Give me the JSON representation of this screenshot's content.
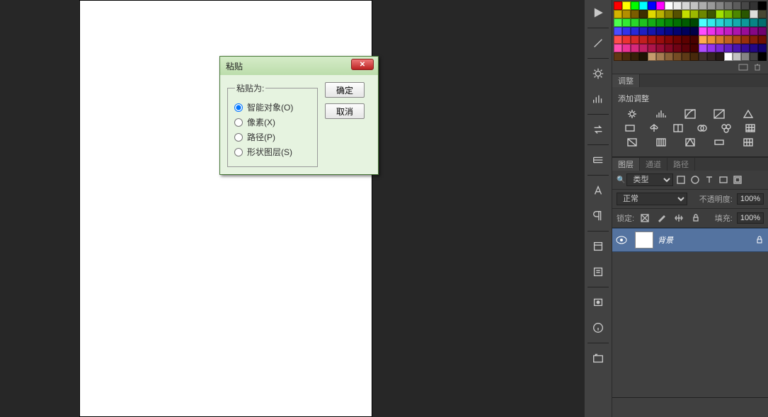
{
  "dialog": {
    "title": "粘贴",
    "fieldset_legend": "粘贴为:",
    "options": [
      {
        "label": "智能对象(O)",
        "checked": true
      },
      {
        "label": "像素(X)",
        "checked": false
      },
      {
        "label": "路径(P)",
        "checked": false
      },
      {
        "label": "形状图层(S)",
        "checked": false
      }
    ],
    "ok": "确定",
    "cancel": "取消"
  },
  "adjustments": {
    "tab": "调整",
    "add_label": "添加调整"
  },
  "layers_panel": {
    "tabs": {
      "layers": "图层",
      "channels": "通道",
      "paths": "路径"
    },
    "kind_select": "类型",
    "search_icon": "🔍",
    "blend_mode": "正常",
    "opacity_label": "不透明度:",
    "opacity_value": "100%",
    "lock_label": "锁定:",
    "fill_label": "填充:",
    "fill_value": "100%",
    "bg_layer": "背景"
  },
  "swatch_rows": [
    [
      "#ff0000",
      "#ffff00",
      "#00ff00",
      "#00ffff",
      "#0000ff",
      "#ff00ff",
      "#ffffff",
      "#ebebeb",
      "#d6d6d6",
      "#c2c2c2",
      "#adadad",
      "#999999",
      "#858585",
      "#707070",
      "#5c5c5c",
      "#474747",
      "#333333",
      "#000000"
    ],
    [
      "#d4b300",
      "#b38f00",
      "#7a5c00",
      "#3d2e00",
      "#e0d900",
      "#b8b100",
      "#878200",
      "#565100",
      "#c4e000",
      "#9cb800",
      "#6d8700",
      "#3e5600",
      "#a0e000",
      "#78b800",
      "#4d8700",
      "#2a5600",
      "#dededb",
      "#474733"
    ],
    [
      "#4dff4d",
      "#33eb33",
      "#29d629",
      "#1fc21f",
      "#15ad15",
      "#0d990d",
      "#078507",
      "#037003",
      "#015c01",
      "#004700",
      "#4dffff",
      "#33ebeb",
      "#29d6d6",
      "#1fc2c2",
      "#15adad",
      "#0d9999",
      "#078585",
      "#037070"
    ],
    [
      "#4d4dff",
      "#3333eb",
      "#2929d6",
      "#1f1fc2",
      "#1515ad",
      "#0d0d99",
      "#070785",
      "#030370",
      "#01015c",
      "#000047",
      "#ff4dff",
      "#eb33eb",
      "#d629d6",
      "#c21fc2",
      "#ad15ad",
      "#990d99",
      "#850785",
      "#700370"
    ],
    [
      "#ff4d4d",
      "#eb3333",
      "#d62929",
      "#c21f1f",
      "#ad1515",
      "#990d0d",
      "#850707",
      "#700303",
      "#5c0101",
      "#470000",
      "#ffad4d",
      "#eb9333",
      "#d67a29",
      "#c2611f",
      "#ad4815",
      "#99300d",
      "#851e07",
      "#701003"
    ],
    [
      "#ff4daf",
      "#eb3395",
      "#d6297c",
      "#c21f63",
      "#ad154a",
      "#990d35",
      "#850723",
      "#700314",
      "#5c0108",
      "#470000",
      "#af4dff",
      "#9533eb",
      "#7c29d6",
      "#631fc2",
      "#4a15ad",
      "#350d99",
      "#230785",
      "#140370"
    ],
    [
      "#603813",
      "#4a2b0d",
      "#352008",
      "#1f1404",
      "#c69c6d",
      "#a67c52",
      "#8c6239",
      "#754c24",
      "#5e3a16",
      "#47290b",
      "#40302a",
      "#332520",
      "#261a16",
      "#ffffff",
      "#c2c2c2",
      "#858585",
      "#424242",
      "#000000"
    ]
  ]
}
